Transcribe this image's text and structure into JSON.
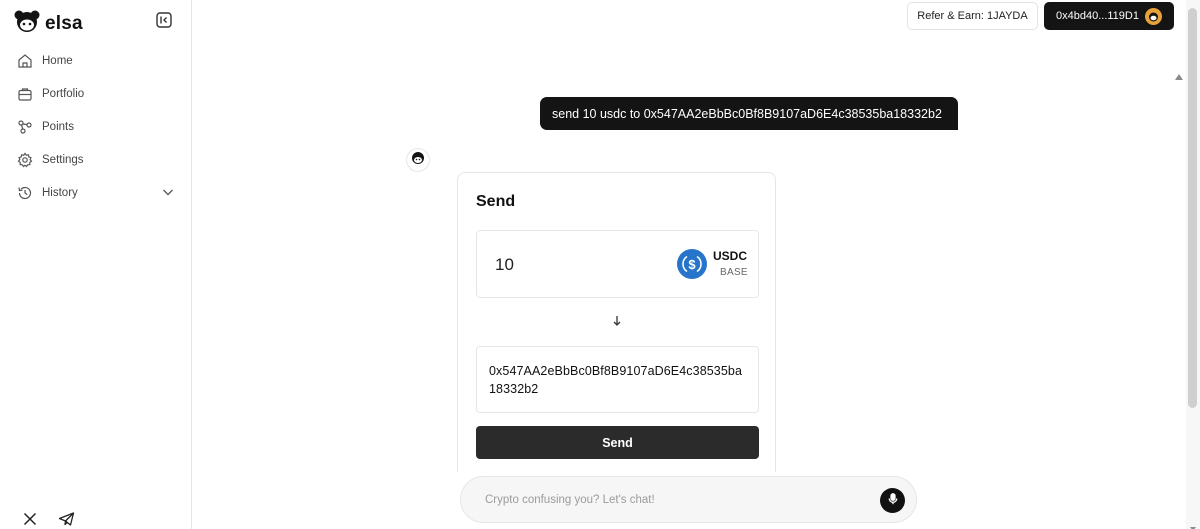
{
  "brand": {
    "name": "elsa"
  },
  "sidebar": {
    "items": [
      {
        "label": "Home",
        "icon": "home-icon"
      },
      {
        "label": "Portfolio",
        "icon": "portfolio-icon"
      },
      {
        "label": "Points",
        "icon": "points-icon"
      },
      {
        "label": "Settings",
        "icon": "gear-icon"
      },
      {
        "label": "History",
        "icon": "history-icon"
      }
    ],
    "social": [
      "x-icon",
      "telegram-icon"
    ]
  },
  "header": {
    "refer_label": "Refer & Earn: 1JAYDA",
    "wallet_label": "0x4bd40...119D1"
  },
  "chat": {
    "user_message": "send 10 usdc to 0x547AA2eBbBc0Bf8B9107aD6E4c38535ba18332b2",
    "input_placeholder": "Crypto confusing you? Let's chat!"
  },
  "send_card": {
    "title": "Send",
    "amount": "10",
    "token_symbol": "USDC",
    "token_chain": "BASE",
    "recipient": "0x547AA2eBbBc0Bf8B9107aD6E4c38535ba18332b2",
    "button_label": "Send"
  },
  "colors": {
    "primary_dark": "#141414",
    "usdc_blue": "#2775ca",
    "border": "#e6e6e6"
  }
}
